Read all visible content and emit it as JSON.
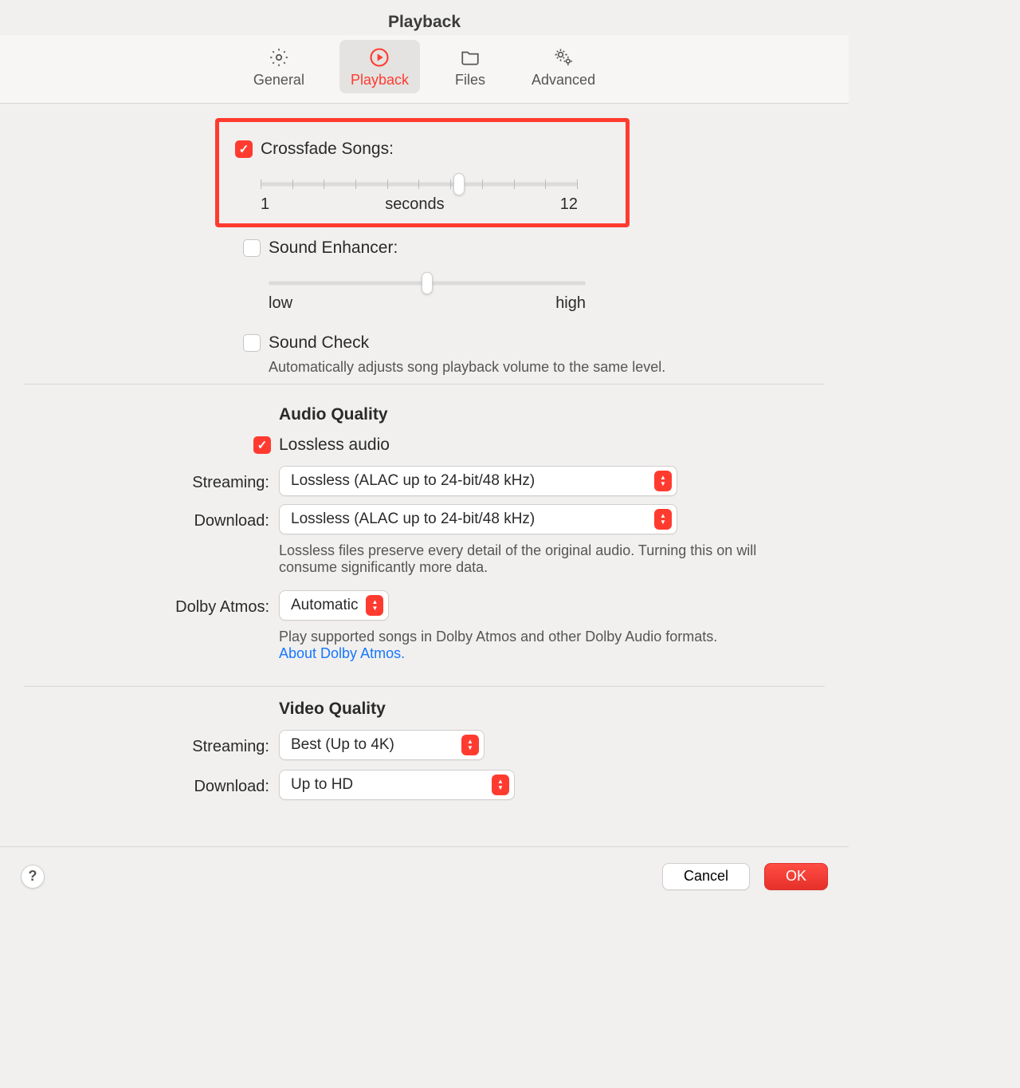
{
  "title": "Playback",
  "tabs": {
    "general": "General",
    "playback": "Playback",
    "files": "Files",
    "advanced": "Advanced"
  },
  "crossfade": {
    "label": "Crossfade Songs:",
    "checked": true,
    "min_label": "1",
    "unit_label": "seconds",
    "max_label": "12",
    "thumb_frac": 0.625
  },
  "enhancer": {
    "label": "Sound Enhancer:",
    "checked": false,
    "low_label": "low",
    "high_label": "high",
    "thumb_frac": 0.5
  },
  "soundcheck": {
    "label": "Sound Check",
    "checked": false,
    "desc": "Automatically adjusts song playback volume to the same level."
  },
  "audio": {
    "heading": "Audio Quality",
    "lossless_label": "Lossless audio",
    "lossless_checked": true,
    "streaming_label": "Streaming:",
    "streaming_value": "Lossless (ALAC up to 24-bit/48 kHz)",
    "download_label": "Download:",
    "download_value": "Lossless (ALAC up to 24-bit/48 kHz)",
    "lossless_desc": "Lossless files preserve every detail of the original audio. Turning this on will consume significantly more data.",
    "atmos_label": "Dolby Atmos:",
    "atmos_value": "Automatic",
    "atmos_desc": "Play supported songs in Dolby Atmos and other Dolby Audio formats.",
    "atmos_link": "About Dolby Atmos."
  },
  "video": {
    "heading": "Video Quality",
    "streaming_label": "Streaming:",
    "streaming_value": "Best (Up to 4K)",
    "download_label": "Download:",
    "download_value": "Up to HD"
  },
  "buttons": {
    "help": "?",
    "cancel": "Cancel",
    "ok": "OK"
  }
}
